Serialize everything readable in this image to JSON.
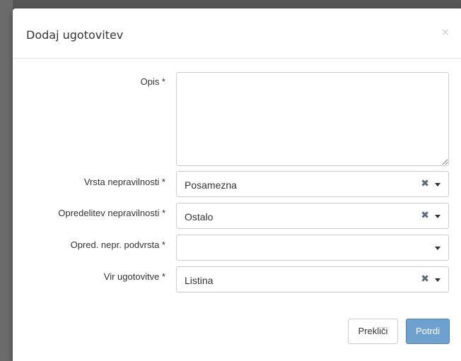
{
  "dialog": {
    "title": "Dodaj ugotovitev",
    "close_glyph": "×"
  },
  "form": {
    "description": {
      "label": "Opis *",
      "value": ""
    },
    "irregularity_type": {
      "label": "Vrsta nepravilnosti *",
      "value": "Posamezna"
    },
    "irregularity_determination": {
      "label": "Opredelitev nepravilnosti *",
      "value": "Ostalo"
    },
    "irregularity_subtype": {
      "label": "Opred. nepr. podvrsta *",
      "value": ""
    },
    "finding_source": {
      "label": "Vir ugotovitve *",
      "value": "Listina"
    }
  },
  "footer": {
    "cancel_label": "Prekliči",
    "confirm_label": "Potrdi"
  },
  "icons": {
    "clear": "x-icon",
    "dropdown": "caret-down-icon",
    "close": "close-icon"
  },
  "colors": {
    "primary_button": "#6ea0d0",
    "clear_icon": "#5f6b78"
  }
}
